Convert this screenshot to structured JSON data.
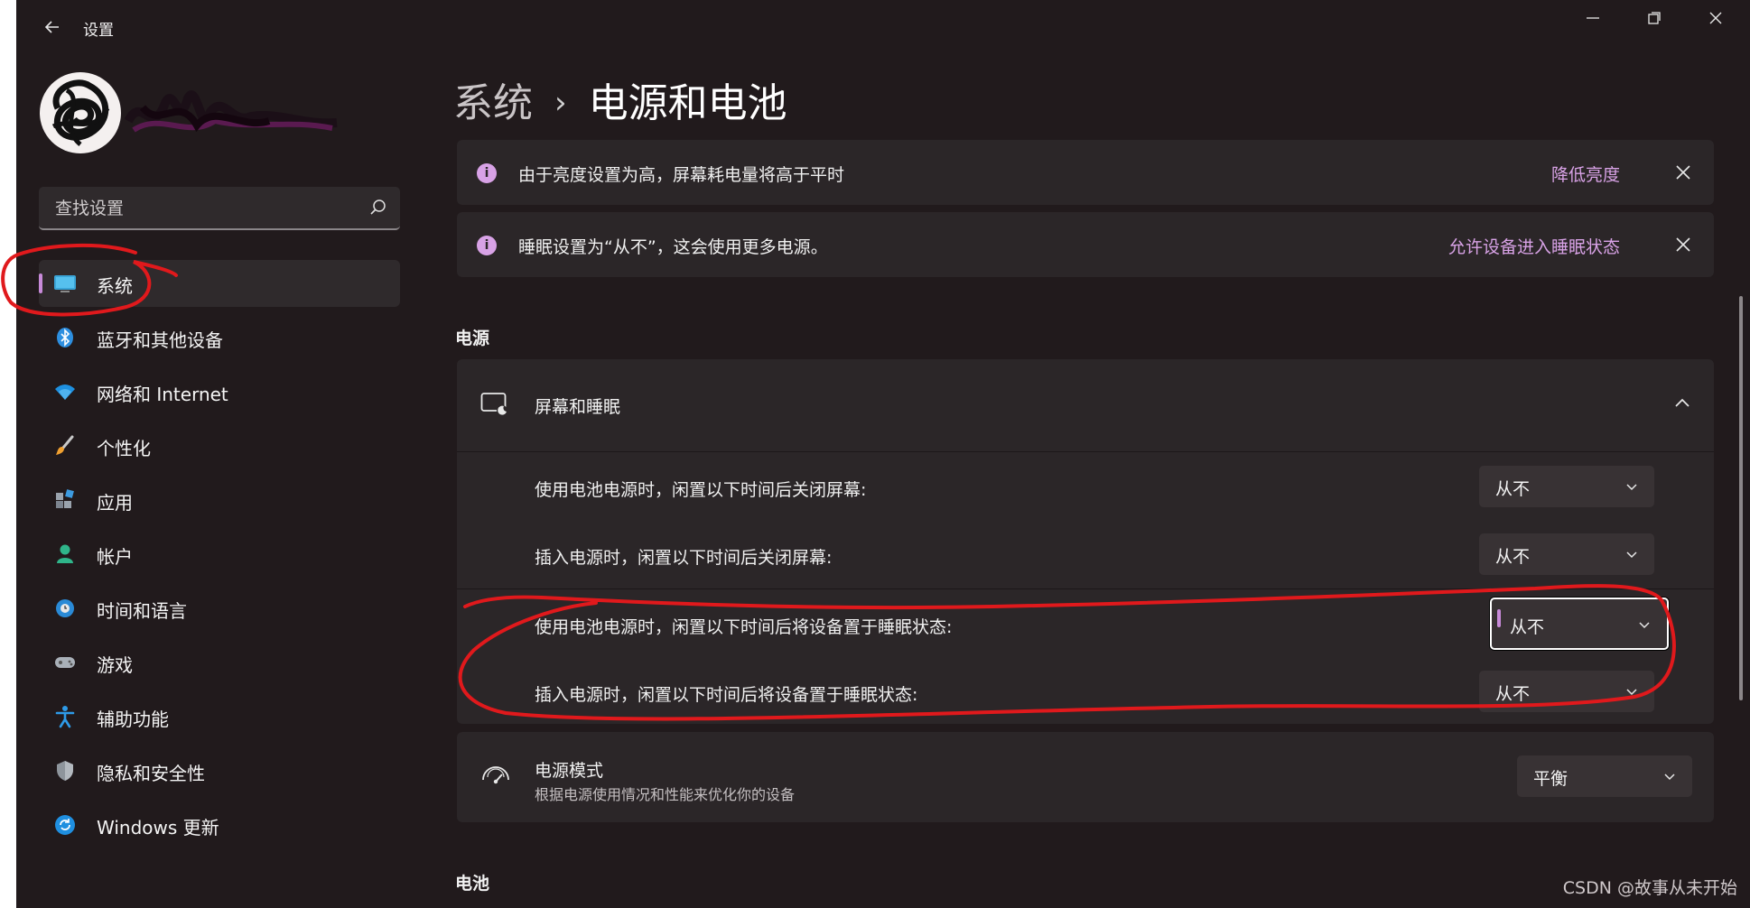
{
  "app": {
    "title": "设置"
  },
  "window_controls": [
    "minimize",
    "maximize",
    "close"
  ],
  "search": {
    "placeholder": "查找设置"
  },
  "sidebar": {
    "items": [
      {
        "label": "系统",
        "icon": "monitor-icon",
        "active": true
      },
      {
        "label": "蓝牙和其他设备",
        "icon": "bluetooth-icon"
      },
      {
        "label": "网络和 Internet",
        "icon": "wifi-icon"
      },
      {
        "label": "个性化",
        "icon": "brush-icon"
      },
      {
        "label": "应用",
        "icon": "apps-icon"
      },
      {
        "label": "帐户",
        "icon": "person-icon"
      },
      {
        "label": "时间和语言",
        "icon": "globe-clock-icon"
      },
      {
        "label": "游戏",
        "icon": "gamepad-icon"
      },
      {
        "label": "辅助功能",
        "icon": "accessibility-icon"
      },
      {
        "label": "隐私和安全性",
        "icon": "shield-icon"
      },
      {
        "label": "Windows 更新",
        "icon": "update-icon"
      }
    ]
  },
  "breadcrumb": {
    "parent": "系统",
    "current": "电源和电池"
  },
  "notices": [
    {
      "text": "由于亮度设置为高，屏幕耗电量将高于平时",
      "action": "降低亮度"
    },
    {
      "text": "睡眠设置为“从不”，这会使用更多电源。",
      "action": "允许设备进入睡眠状态"
    }
  ],
  "power": {
    "heading": "电源",
    "screen_sleep": {
      "title": "屏幕和睡眠",
      "expanded": true,
      "rows": [
        {
          "label": "使用电池电源时，闲置以下时间后关闭屏幕:",
          "value": "从不"
        },
        {
          "label": "插入电源时，闲置以下时间后关闭屏幕:",
          "value": "从不"
        },
        {
          "label": "使用电池电源时，闲置以下时间后将设备置于睡眠状态:",
          "value": "从不",
          "focused": true
        },
        {
          "label": "插入电源时，闲置以下时间后将设备置于睡眠状态:",
          "value": "从不"
        }
      ]
    },
    "power_mode": {
      "title": "电源模式",
      "subtitle": "根据电源使用情况和性能来优化你的设备",
      "value": "平衡"
    }
  },
  "battery": {
    "heading": "电池"
  },
  "watermark": "CSDN @故事从未开始",
  "colors": {
    "background": "#211a1c",
    "card": "#2b2628",
    "accent": "#c88ad9",
    "link": "#d8a2e6",
    "annotation": "#e0191c"
  }
}
